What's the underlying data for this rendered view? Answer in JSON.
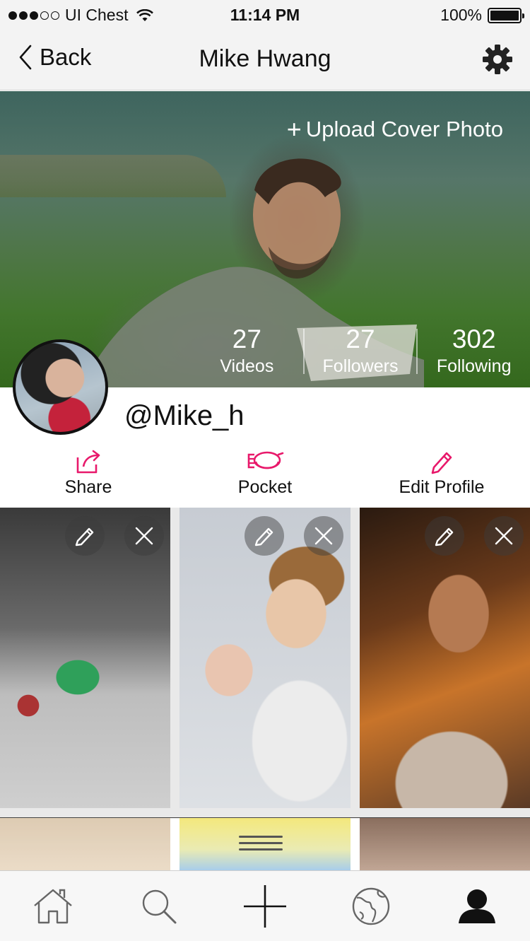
{
  "status_bar": {
    "carrier": "UI Chest",
    "time": "11:14 PM",
    "battery": "100%",
    "signal_bars_filled": 3,
    "signal_bars_total": 5
  },
  "nav": {
    "back_label": "Back",
    "title": "Mike Hwang",
    "settings_icon": "gear-icon"
  },
  "cover": {
    "upload_label": "Upload Cover Photo",
    "upload_icon": "plus-icon"
  },
  "stats": [
    {
      "value": "27",
      "label": "Videos"
    },
    {
      "value": "27",
      "label": "Followers"
    },
    {
      "value": "302",
      "label": "Following"
    }
  ],
  "profile": {
    "username": "@Mike_h"
  },
  "actions": [
    {
      "label": "Share",
      "icon": "share-icon"
    },
    {
      "label": "Pocket",
      "icon": "pocket-icon"
    },
    {
      "label": "Edit Profile",
      "icon": "pencil-icon"
    }
  ],
  "videos": [
    {
      "edit_icon": "pencil-icon",
      "delete_icon": "close-icon"
    },
    {
      "edit_icon": "pencil-icon",
      "delete_icon": "close-icon"
    },
    {
      "edit_icon": "pencil-icon",
      "delete_icon": "close-icon"
    }
  ],
  "tab_bar": {
    "tabs": [
      "home-icon",
      "search-icon",
      "plus-icon",
      "globe-icon",
      "profile-icon"
    ],
    "active": "profile-icon"
  },
  "colors": {
    "accent": "#e8196b",
    "bar_background": "#f3f3f3",
    "text": "#111111"
  }
}
